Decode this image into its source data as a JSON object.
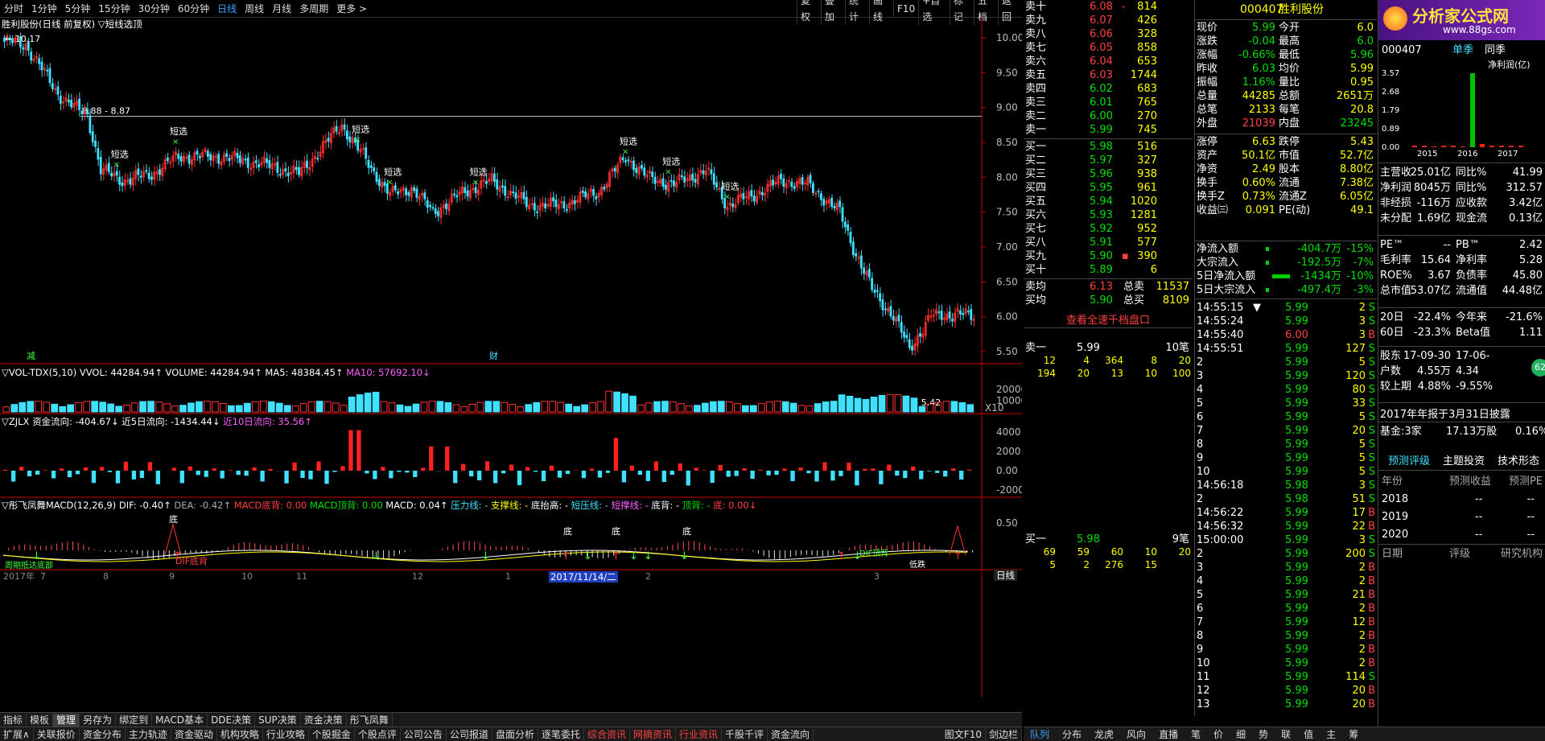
{
  "toolbar": {
    "periods": [
      "分时",
      "1分钟",
      "5分钟",
      "15分钟",
      "30分钟",
      "60分钟",
      "日线",
      "周线",
      "月线",
      "多周期",
      "更多"
    ],
    "right_buttons": [
      "复权",
      "叠加",
      "统计",
      "画线",
      "F10",
      "+自选",
      "标记",
      "五档",
      "返回"
    ]
  },
  "chart": {
    "title": "胜利股份(日线 前复权) ▽短线选顶",
    "high_label": "10.17",
    "level_label": "8.88 - 8.87",
    "low_label": "5.42",
    "signal_label": "短选",
    "event_labels": [
      "减",
      "财"
    ],
    "price_axis": [
      "10.00",
      "9.50",
      "9.00",
      "8.50",
      "8.00",
      "7.50",
      "7.00",
      "6.50",
      "6.00",
      "5.50"
    ],
    "vol_title": {
      "name": "▽VOL-TDX(5,10)",
      "vvol": "VVOL: 44284.94↑",
      "volume": "VOLUME: 44284.94↑",
      "ma5": "MA5: 48384.45↑",
      "ma10": "MA10: 57692.10↓"
    },
    "vol_axis": [
      "20000",
      "10000"
    ],
    "vol_unit": "X10",
    "zjlx_title": {
      "name": "▽ZJLX",
      "flow": "资金流向: -404.67↓",
      "f5": "近5日流向: -1434.44↓",
      "f10": "近10日流向: 35.56↑"
    },
    "zjlx_axis": [
      "4000",
      "2000",
      "0.00",
      "-2000"
    ],
    "macd_title": {
      "name": "▽彤飞凤舞MACD(12,26,9)",
      "dif": "DIF: -0.40↑",
      "dea": "DEA: -0.42↑",
      "bottom": "MACD底背: 0.00",
      "top": "MACD顶背: 0.00",
      "macd": "MACD: 0.04↑",
      "press": "压力线: -",
      "support": "支撑线: -",
      "rise": "底抬高: -",
      "bpress": "短压线: -",
      "bsupp": "短撑线: -",
      "bdev": "底背: -",
      "tdev": "顶背: -",
      "di": "底: 0.00↓"
    },
    "macd_axis": [
      "0.50"
    ],
    "macd_labels": {
      "di": "底",
      "dif_bottom": "DIF底背",
      "dif_top": "DIF顶背",
      "low_time": "周期抵达底部",
      "dif_low": "DIF底背",
      "low2": "低跌"
    },
    "date_axis": [
      "2017年",
      "7",
      "8",
      "9",
      "10",
      "11",
      "12",
      "1",
      "2",
      "3"
    ],
    "date_cursor": "2017/11/14/二",
    "period_badge": "日线"
  },
  "orderbook": {
    "sells": [
      {
        "l": "卖十",
        "p": "6.08",
        "v": "814",
        "m": "-"
      },
      {
        "l": "卖九",
        "p": "6.07",
        "v": "426",
        "m": ""
      },
      {
        "l": "卖八",
        "p": "6.06",
        "v": "328",
        "m": ""
      },
      {
        "l": "卖七",
        "p": "6.05",
        "v": "858",
        "m": ""
      },
      {
        "l": "卖六",
        "p": "6.04",
        "v": "653",
        "m": ""
      },
      {
        "l": "卖五",
        "p": "6.03",
        "v": "1744",
        "m": ""
      },
      {
        "l": "卖四",
        "p": "6.02",
        "v": "683",
        "m": ""
      },
      {
        "l": "卖三",
        "p": "6.01",
        "v": "765",
        "m": ""
      },
      {
        "l": "卖二",
        "p": "6.00",
        "v": "270",
        "m": ""
      },
      {
        "l": "卖一",
        "p": "5.99",
        "v": "745",
        "m": ""
      }
    ],
    "buys": [
      {
        "l": "买一",
        "p": "5.98",
        "v": "516"
      },
      {
        "l": "买二",
        "p": "5.97",
        "v": "327"
      },
      {
        "l": "买三",
        "p": "5.96",
        "v": "938"
      },
      {
        "l": "买四",
        "p": "5.95",
        "v": "961"
      },
      {
        "l": "买五",
        "p": "5.94",
        "v": "1020"
      },
      {
        "l": "买六",
        "p": "5.93",
        "v": "1281"
      },
      {
        "l": "买七",
        "p": "5.92",
        "v": "952"
      },
      {
        "l": "买八",
        "p": "5.91",
        "v": "577"
      },
      {
        "l": "买九",
        "p": "5.90",
        "v": "390",
        "m": "▪"
      },
      {
        "l": "买十",
        "p": "5.89",
        "v": "6"
      }
    ],
    "avg_sell": {
      "l": "卖均",
      "p": "6.13",
      "k": "总卖",
      "v": "11537"
    },
    "avg_buy": {
      "l": "买均",
      "p": "5.90",
      "k": "总买",
      "v": "8109"
    },
    "link": "查看全速千档盘口",
    "sell1": {
      "l": "卖一",
      "p": "5.99",
      "n": "10笔",
      "q": [
        "12",
        "4",
        "364",
        "8",
        "20",
        "194",
        "20",
        "13",
        "10",
        "100"
      ]
    },
    "buy1": {
      "l": "买一",
      "p": "5.98",
      "n": "9笔",
      "q": [
        "69",
        "59",
        "60",
        "10",
        "20",
        "5",
        "2",
        "276",
        "15",
        ""
      ]
    }
  },
  "quote": {
    "code": "000407",
    "name": "胜利股份",
    "rows": [
      [
        "现价",
        "5.99",
        "今开",
        "6.0"
      ],
      [
        "涨跌",
        "-0.04",
        "最高",
        "6.0"
      ],
      [
        "涨幅",
        "-0.66%",
        "最低",
        "5.96"
      ],
      [
        "昨收",
        "6.03",
        "均价",
        "5.99"
      ],
      [
        "振幅",
        "1.16%",
        "量比",
        "0.95"
      ],
      [
        "总量",
        "44285",
        "总额",
        "2651万"
      ],
      [
        "总笔",
        "2133",
        "每笔",
        "20.8"
      ],
      [
        "外盘",
        "21039",
        "内盘",
        "23245"
      ],
      [
        "涨停",
        "6.63",
        "跌停",
        "5.43"
      ],
      [
        "资产",
        "50.1亿",
        "市值",
        "52.7亿"
      ],
      [
        "净资",
        "2.49",
        "股本",
        "8.80亿"
      ],
      [
        "换手",
        "0.60%",
        "流通",
        "7.38亿"
      ],
      [
        "换手Z",
        "0.73%",
        "流通Z",
        "6.05亿"
      ],
      [
        "收益㈢",
        "0.091",
        "PE(动)",
        "49.1"
      ]
    ],
    "flows": [
      [
        "净流入额",
        "-404.7万",
        "-15%"
      ],
      [
        "大宗流入",
        "-192.5万",
        "-7%"
      ],
      [
        "5日净流入额",
        "-1434万",
        "-10%"
      ],
      [
        "5日大宗流入",
        "-497.4万",
        "-3%"
      ]
    ],
    "ticks": [
      [
        "14:55:15",
        "▼",
        "5.99",
        "2",
        "S"
      ],
      [
        "14:55:24",
        "",
        "5.99",
        "3",
        "S"
      ],
      [
        "14:55:40",
        "",
        "6.00",
        "3",
        "B"
      ],
      [
        "14:55:51",
        "",
        "5.99",
        "127",
        "S"
      ],
      [
        "2",
        "",
        "5.99",
        "5",
        "S"
      ],
      [
        "3",
        "",
        "5.99",
        "120",
        "S"
      ],
      [
        "4",
        "",
        "5.99",
        "80",
        "S"
      ],
      [
        "5",
        "",
        "5.99",
        "33",
        "S"
      ],
      [
        "6",
        "",
        "5.99",
        "5",
        "S"
      ],
      [
        "7",
        "",
        "5.99",
        "20",
        "S"
      ],
      [
        "8",
        "",
        "5.99",
        "5",
        "S"
      ],
      [
        "9",
        "",
        "5.99",
        "5",
        "S"
      ],
      [
        "10",
        "",
        "5.99",
        "5",
        "S"
      ],
      [
        "14:56:18",
        "",
        "5.98",
        "3",
        "S"
      ],
      [
        "2",
        "",
        "5.98",
        "51",
        "S"
      ],
      [
        "14:56:22",
        "",
        "5.99",
        "17",
        "B"
      ],
      [
        "14:56:32",
        "",
        "5.99",
        "22",
        "B"
      ],
      [
        "15:00:00",
        "",
        "5.99",
        "3",
        "S"
      ],
      [
        "2",
        "",
        "5.99",
        "200",
        "S"
      ],
      [
        "3",
        "",
        "5.99",
        "2",
        "B"
      ],
      [
        "4",
        "",
        "5.99",
        "2",
        "B"
      ],
      [
        "5",
        "",
        "5.99",
        "21",
        "B"
      ],
      [
        "6",
        "",
        "5.99",
        "2",
        "B"
      ],
      [
        "7",
        "",
        "5.99",
        "12",
        "B"
      ],
      [
        "8",
        "",
        "5.99",
        "2",
        "B"
      ],
      [
        "9",
        "",
        "5.99",
        "2",
        "B"
      ],
      [
        "10",
        "",
        "5.99",
        "2",
        "B"
      ],
      [
        "11",
        "",
        "5.99",
        "114",
        "S"
      ],
      [
        "12",
        "",
        "5.99",
        "20",
        "B"
      ],
      [
        "13",
        "",
        "5.99",
        "20",
        "B"
      ]
    ]
  },
  "fund": {
    "site": "分析家公式网",
    "site_url": "www.88gs.com",
    "code": "000407",
    "tab1": "单季",
    "tab2": "同季",
    "metric": "净利润(亿)",
    "bar_axis": [
      "3.57",
      "2.68",
      "1.79",
      "0.89",
      "0.00"
    ],
    "bar_years": [
      "2015",
      "2016",
      "2017"
    ],
    "bar_values": [
      0.06,
      0.08,
      0.05,
      0.07,
      0.09,
      0.05,
      3.57,
      0.14,
      0.06,
      0.07,
      0.08,
      0.09
    ],
    "rows": [
      [
        "主营收",
        "25.01亿",
        "同比%",
        "41.99"
      ],
      [
        "净利润",
        "8045万",
        "同比%",
        "312.57"
      ],
      [
        "非经损",
        "-116万",
        "应收款",
        "3.42亿"
      ],
      [
        "未分配",
        "1.69亿",
        "现金流",
        "0.13亿"
      ]
    ],
    "rows2": [
      [
        "PE™",
        "--",
        "PB™",
        "2.42"
      ],
      [
        "毛利率",
        "15.64",
        "净利率",
        "5.28"
      ],
      [
        "ROE%",
        "3.67",
        "负债率",
        "45.80"
      ],
      [
        "总市值",
        "53.07亿",
        "流通值",
        "44.48亿"
      ]
    ],
    "rows3": [
      [
        "20日",
        "-22.4%",
        "今年来",
        "-21.6%"
      ],
      [
        "60日",
        "-23.3%",
        "Beta值",
        "1.11"
      ]
    ],
    "rows4": [
      [
        "股东",
        "17-09-30",
        "17-06-",
        ""
      ],
      [
        "户数",
        "4.55万",
        "4.34",
        ""
      ],
      [
        "较上期",
        "4.88%",
        "-9.55%",
        ""
      ]
    ],
    "report": "2017年年报于3月31日披露",
    "fundinfo": [
      "基金",
      ":3家",
      "17.13万股",
      "0.16%"
    ],
    "tabs": [
      "预测评级",
      "主题投资",
      "技术形态"
    ],
    "forecast_head": [
      "年份",
      "预测收益",
      "预测PE"
    ],
    "forecast": [
      [
        "2018",
        "--",
        "--"
      ],
      [
        "2019",
        "--",
        "--"
      ],
      [
        "2020",
        "--",
        "--"
      ]
    ],
    "rating_head": [
      "日期",
      "评级",
      "研究机构"
    ],
    "badge": "62"
  },
  "bottom1": [
    "指标",
    "模板",
    "管理",
    "另存为",
    "绑定到",
    "MACD基本",
    "DDE决策",
    "SUP决策",
    "资金决策",
    "彤飞凤舞"
  ],
  "bottom2": [
    "扩展∧",
    "关联报价",
    "资金分布",
    "主力轨迹",
    "资金驱动",
    "机构攻略",
    "行业攻略",
    "个股掘金",
    "个股点评",
    "公司公告",
    "公司报道",
    "盘面分析",
    "逐笔委托",
    "综合资讯",
    "网摘资讯",
    "行业资讯",
    "千股千评",
    "资金流向"
  ],
  "bottom2_right": [
    "图文F10",
    "剑边栏"
  ],
  "bottom3": [
    "队列",
    "分布",
    "龙虎",
    "风向",
    "直播",
    "笔",
    "价",
    "细",
    "势",
    "联",
    "值",
    "主",
    "筹"
  ]
}
